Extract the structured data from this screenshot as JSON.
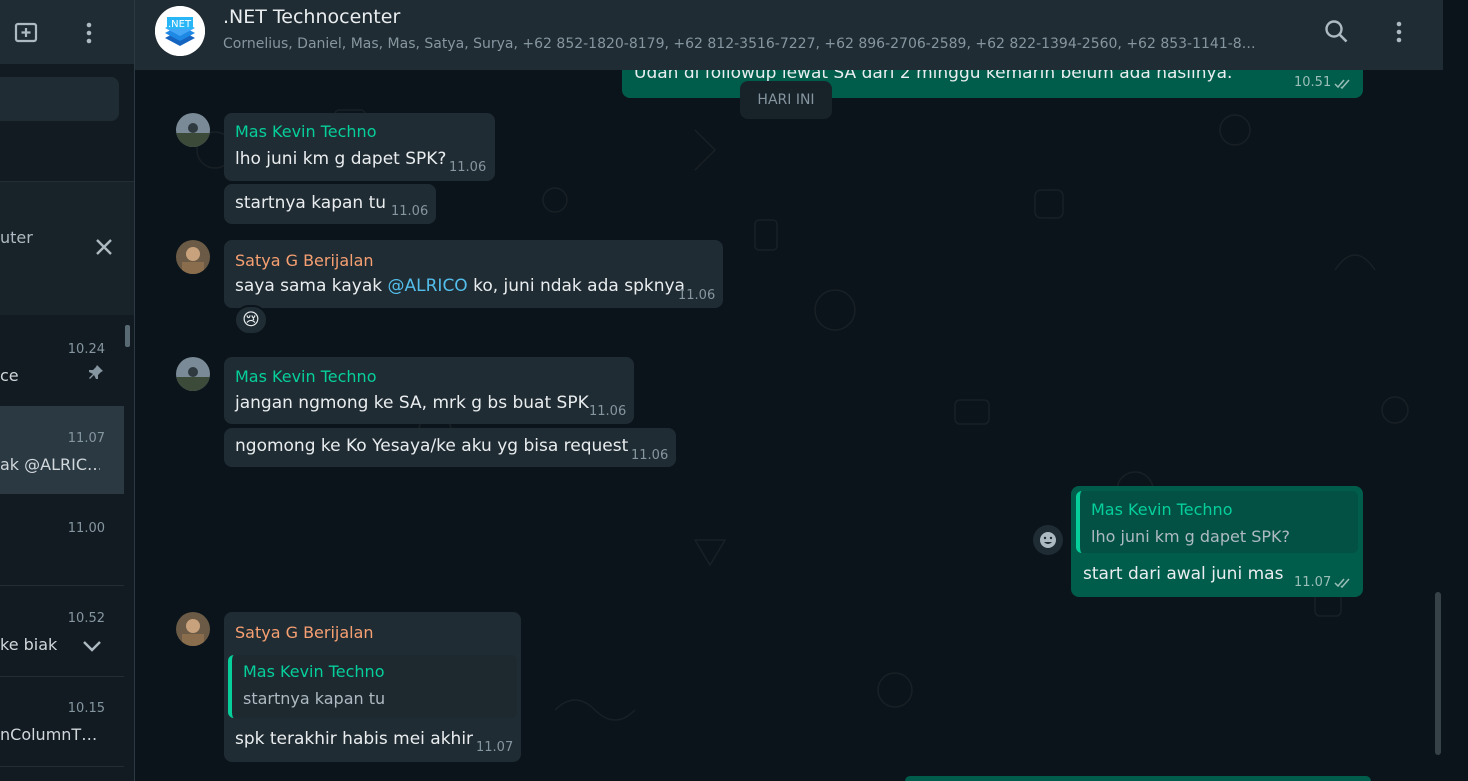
{
  "sidebar": {
    "new_chat_icon": "new-chat-icon",
    "menu_icon": "menu-dots-icon",
    "banner_text": "uter",
    "chats": [
      {
        "time": "10.24",
        "preview": "ce",
        "pinned": true
      },
      {
        "time": "11.07",
        "preview": "ak @ALRIC…",
        "active": true
      },
      {
        "time": "11.00",
        "preview": ""
      },
      {
        "time": "10.52",
        "preview": "ke biak"
      },
      {
        "time": "10.15",
        "preview": "nColumnT…"
      }
    ]
  },
  "header": {
    "avatar_text": ".NET",
    "title": ".NET Technocenter",
    "members": "Cornelius, Daniel, Mas, Mas, Satya, Surya, +62 852-1820-8179, +62 812-3516-7227, +62 896-2706-2589, +62 822-1394-2560, +62 853-1141-8…"
  },
  "day_divider": "HARI INI",
  "messages": {
    "top_out": {
      "text": "Udah di followup lewat SA dari 2 minggu kemarin belum ada hasilnya.",
      "time": "10.51"
    },
    "m1": {
      "sender": "Mas Kevin Techno",
      "text": "lho juni km g dapet SPK?",
      "time": "11.06"
    },
    "m2": {
      "text": "startnya kapan tu",
      "time": "11.06"
    },
    "m3": {
      "sender": "Satya G Berijalan",
      "text_before": "saya sama kayak ",
      "mention": "@ALRICO",
      "text_after": " ko, juni ndak ada spknya",
      "time": "11.06",
      "reaction": "😢"
    },
    "m4": {
      "sender": "Mas Kevin Techno",
      "text": "jangan ngmong ke SA, mrk g bs buat SPK",
      "time": "11.06"
    },
    "m5": {
      "text": "ngomong ke Ko Yesaya/ke aku yg bisa request",
      "time": "11.06"
    },
    "m6": {
      "quote_name": "Mas Kevin Techno",
      "quote_text": "lho juni km g dapet SPK?",
      "text": "start dari awal juni mas",
      "time": "11.07"
    },
    "m7": {
      "sender": "Satya G Berijalan",
      "quote_name": "Mas Kevin Techno",
      "quote_text": "startnya kapan tu",
      "text": "spk terakhir habis mei akhir",
      "time": "11.07"
    }
  },
  "colors": {
    "kevin": "#06cf9c",
    "satya": "#f7a072",
    "outgoing": "#005c4b",
    "incoming": "#202c33"
  }
}
